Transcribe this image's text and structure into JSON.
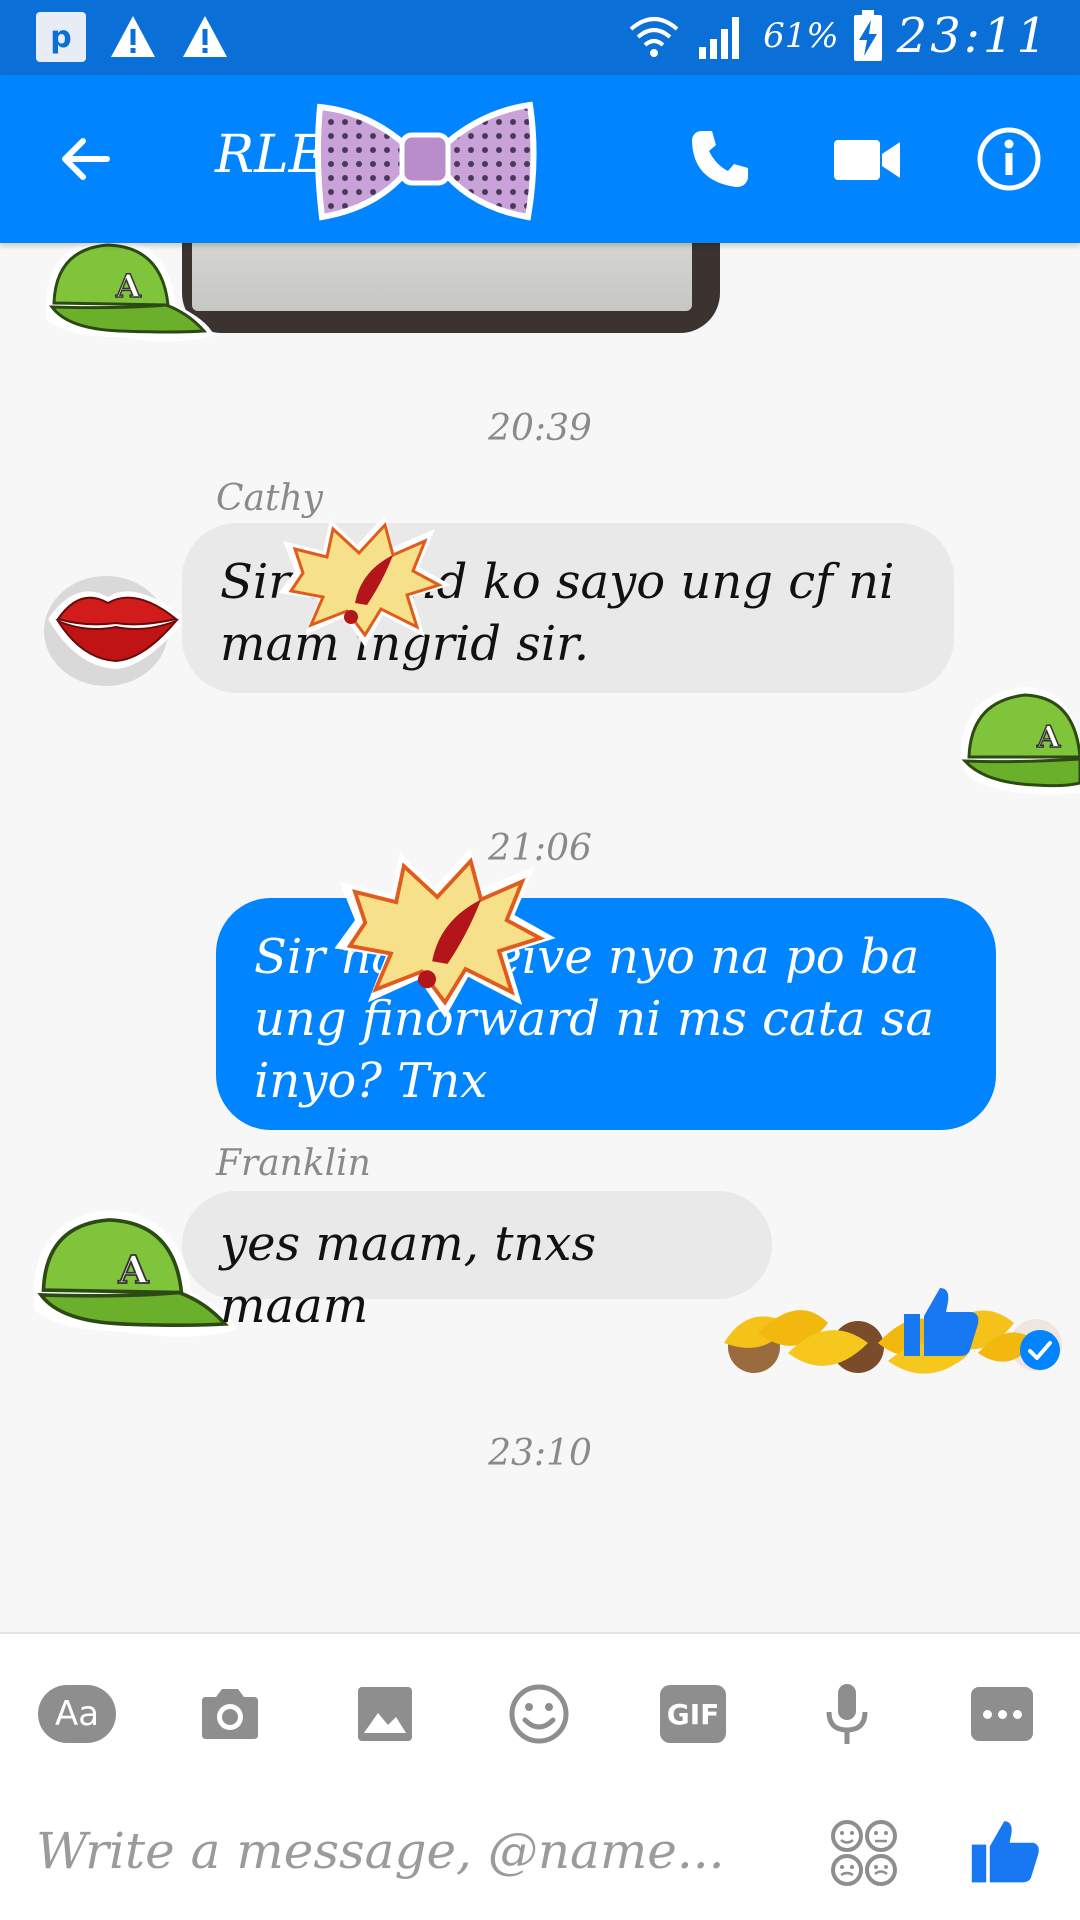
{
  "status_bar": {
    "app_icon_label": "p",
    "battery": "61%",
    "time": "23:11"
  },
  "header": {
    "title": "RLE ...",
    "back_icon": "arrow-left-icon",
    "call_icon": "phone-icon",
    "video_icon": "video-camera-icon",
    "info_icon": "info-icon",
    "colors": {
      "bar": "#0084ff",
      "status": "#0a6fd6"
    }
  },
  "messages": {
    "ts1": "20:39",
    "cathy_name": "Cathy",
    "cathy_text": "Sir        sinend ko sayo ung cf ni  mam ingrid sir.",
    "ts2": "21:06",
    "me_text": "Sir               na receive nyo na po ba ung finorward ni ms cata sa inyo? Tnx",
    "franklin_name": "Franklin",
    "franklin_text": "yes maam, tnxs maam",
    "ts3": "23:10"
  },
  "composer": {
    "aa_label": "Aa",
    "gif_label": "GIF",
    "placeholder": "Write a message, @name...",
    "icons": [
      "aa-icon",
      "camera-icon",
      "image-icon",
      "emoji-icon",
      "gif-icon",
      "microphone-icon",
      "more-icon",
      "sticker-icon",
      "thumbs-up-icon"
    ]
  }
}
